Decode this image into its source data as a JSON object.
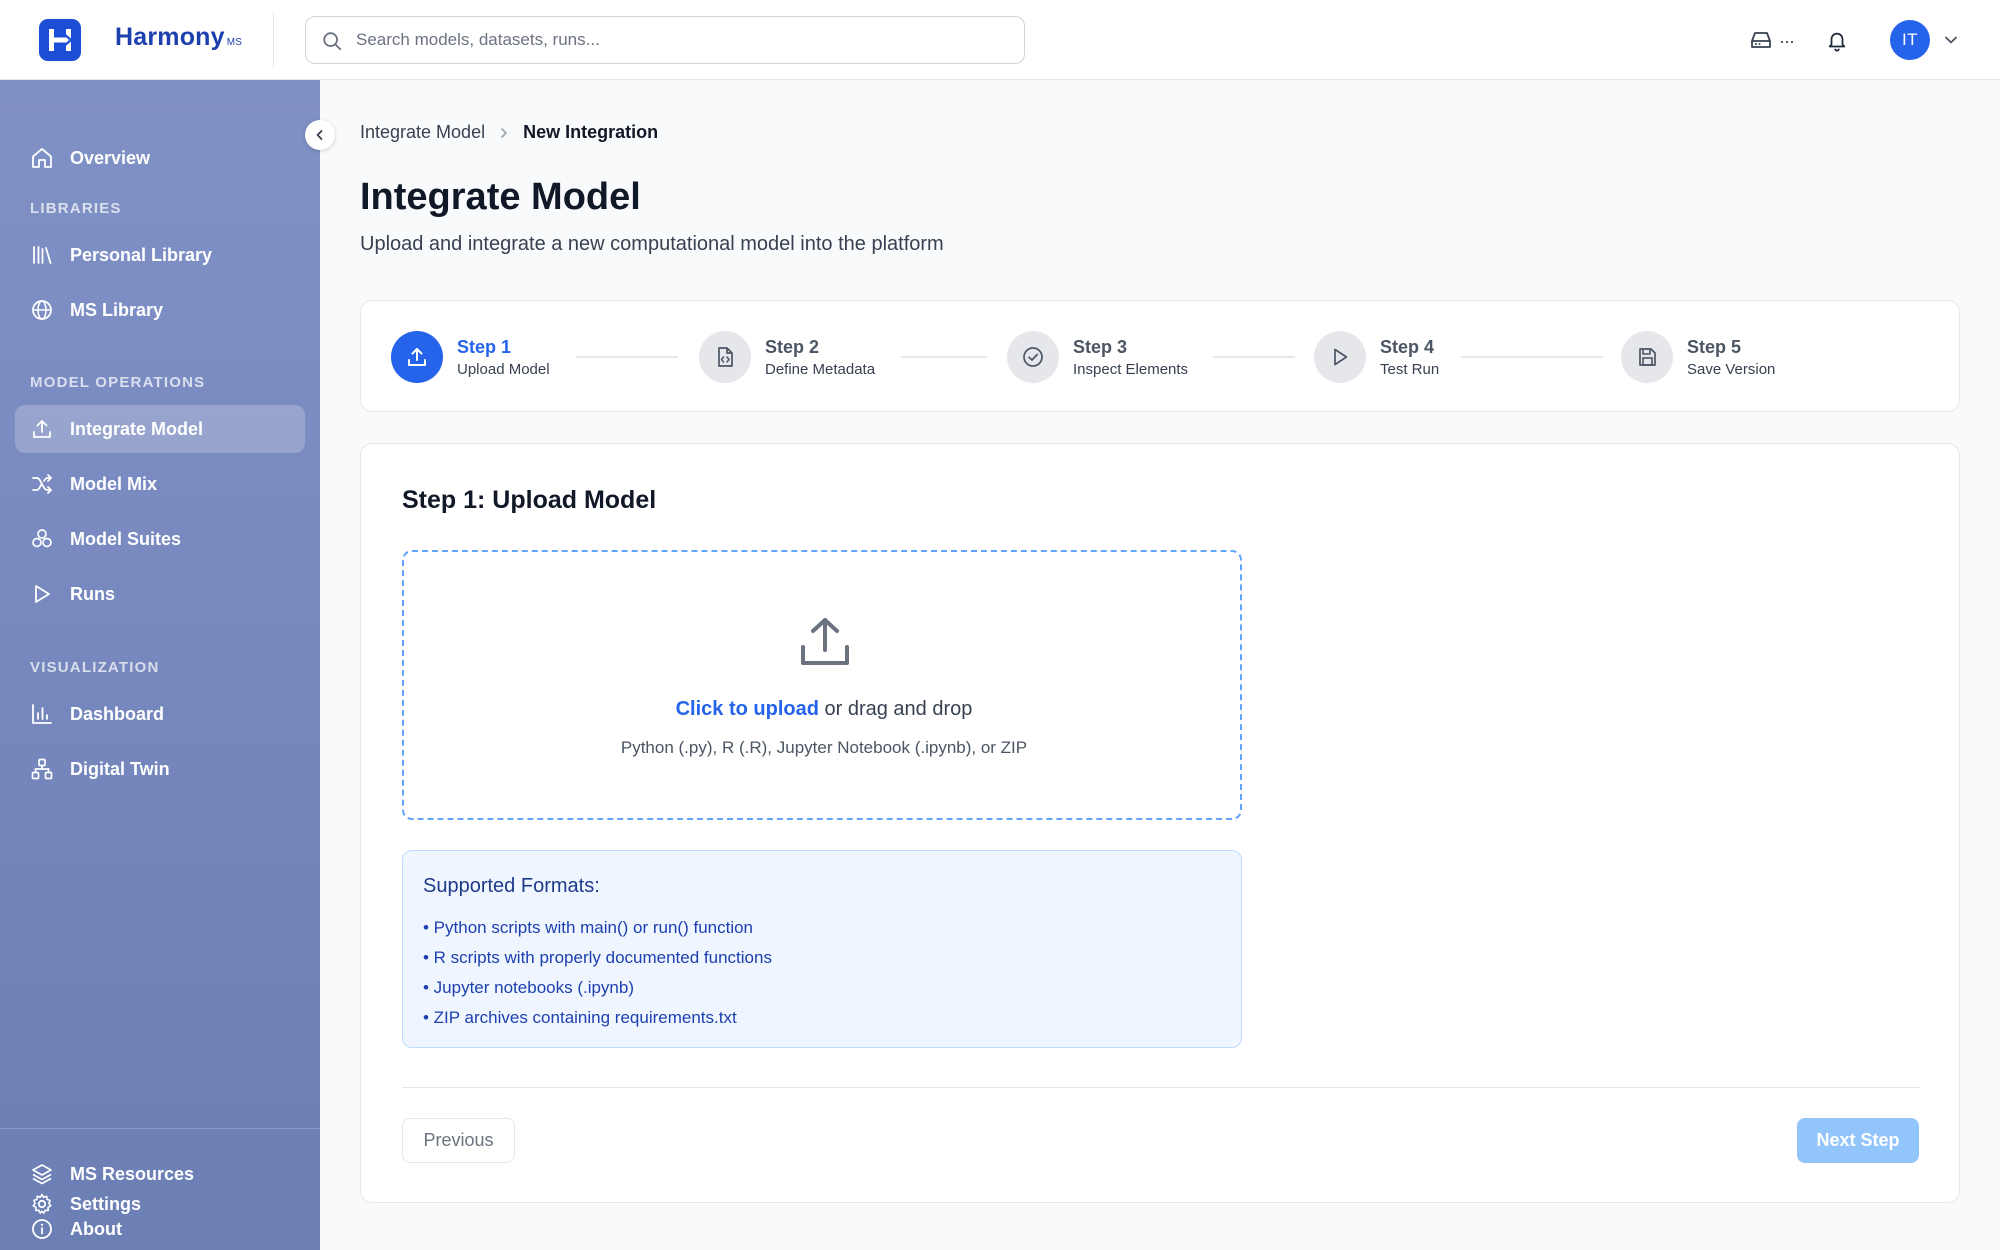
{
  "header": {
    "brand_name": "Harmony",
    "brand_suffix": "MS",
    "search_placeholder": "Search models, datasets, runs...",
    "drive_label": "...",
    "avatar_initials": "IT",
    "accent_color": "#2563eb"
  },
  "sidebar": {
    "overview": "Overview",
    "sections": {
      "libraries": "LIBRARIES",
      "model_operations": "MODEL OPERATIONS",
      "visualization": "VISUALIZATION"
    },
    "items": {
      "personal_library": "Personal Library",
      "ms_library": "MS Library",
      "integrate_model": "Integrate Model",
      "model_mix": "Model Mix",
      "model_suites": "Model Suites",
      "runs": "Runs",
      "dashboard": "Dashboard",
      "digital_twin": "Digital Twin",
      "ms_resources": "MS Resources",
      "about": "About",
      "settings": "Settings"
    },
    "active_item": "integrate_model"
  },
  "breadcrumb": {
    "parent": "Integrate Model",
    "current": "New Integration"
  },
  "page": {
    "title": "Integrate Model",
    "subtitle": "Upload and integrate a new computational model into the platform"
  },
  "stepper": {
    "current_step": 1,
    "steps": [
      {
        "title": "Step 1",
        "description": "Upload Model",
        "icon": "upload-icon"
      },
      {
        "title": "Step 2",
        "description": "Define Metadata",
        "icon": "file-code-icon"
      },
      {
        "title": "Step 3",
        "description": "Inspect Elements",
        "icon": "check-circle-icon"
      },
      {
        "title": "Step 4",
        "description": "Test Run",
        "icon": "play-icon"
      },
      {
        "title": "Step 5",
        "description": "Save Version",
        "icon": "save-icon"
      }
    ]
  },
  "upload": {
    "section_title": "Step 1: Upload Model",
    "click_text": "Click to upload",
    "drag_text": " or drag and drop",
    "hint": "Python (.py), R (.R), Jupyter Notebook (.ipynb), or ZIP"
  },
  "formats": {
    "title": "Supported Formats:",
    "items": [
      "• Python scripts with main() or run() function",
      "• R scripts with properly documented functions",
      "• Jupyter notebooks (.ipynb)",
      "• ZIP archives containing requirements.txt"
    ]
  },
  "actions": {
    "previous": "Previous",
    "next": "Next Step"
  }
}
